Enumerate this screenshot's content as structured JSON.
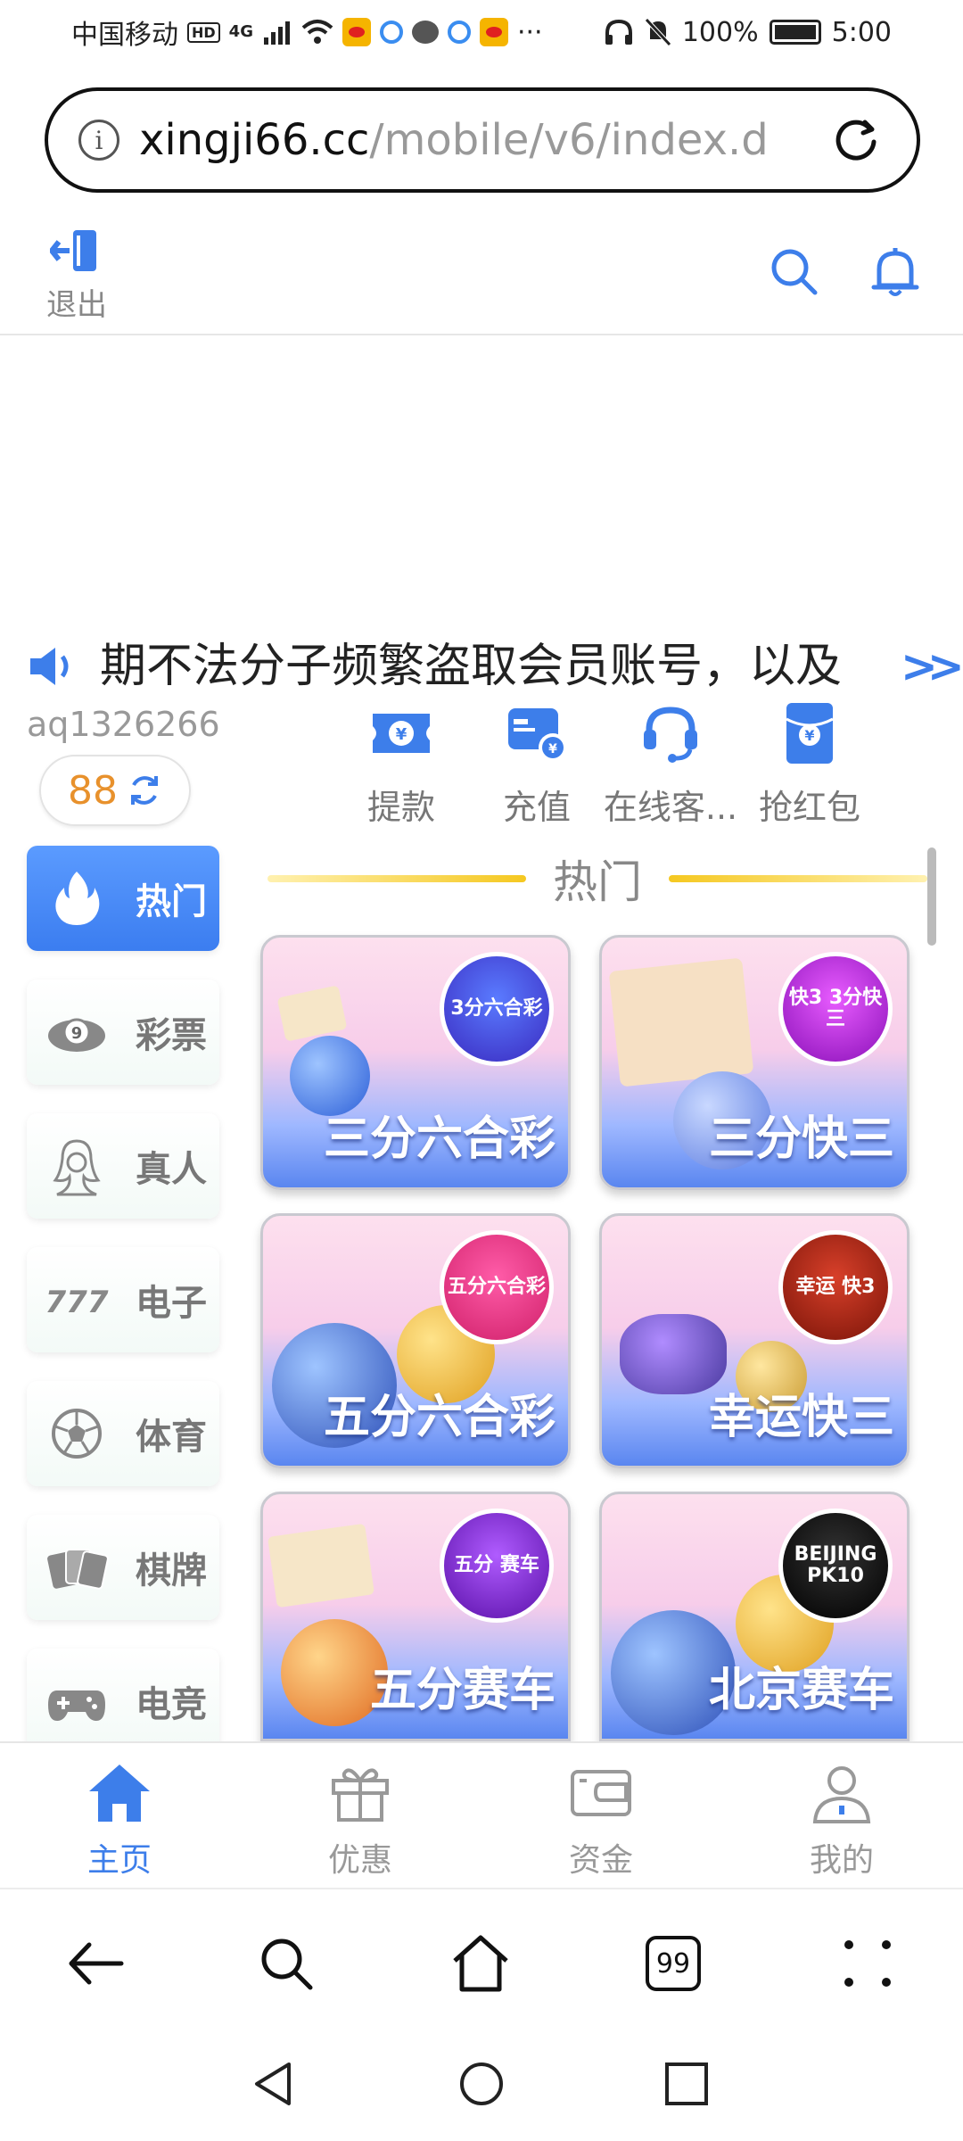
{
  "status_bar": {
    "carrier": "中国移动",
    "hd": "HD",
    "network": "4G",
    "more": "···",
    "battery": "100%",
    "time": "5:00"
  },
  "browser": {
    "url_host": "xingji66.cc",
    "url_path": "/mobile/v6/index.d"
  },
  "header": {
    "logout_label": "退出"
  },
  "notice": {
    "text": "期不法分子频繁盗取会员账号，以及"
  },
  "user": {
    "username": "aq1326266",
    "balance": "88"
  },
  "quick_actions": [
    {
      "label": "提款",
      "icon": "withdraw-ticket-icon"
    },
    {
      "label": "充值",
      "icon": "recharge-wallet-icon"
    },
    {
      "label": "在线客...",
      "icon": "customer-service-headset-icon"
    },
    {
      "label": "抢红包",
      "icon": "red-envelope-icon"
    }
  ],
  "sidebar": {
    "items": [
      {
        "label": "热门",
        "icon": "flame-icon",
        "active": true
      },
      {
        "label": "彩票",
        "icon": "lottery-balls-icon"
      },
      {
        "label": "真人",
        "icon": "live-dealer-icon"
      },
      {
        "label": "电子",
        "icon": "slot-777-icon"
      },
      {
        "label": "体育",
        "icon": "soccer-ball-icon"
      },
      {
        "label": "棋牌",
        "icon": "playing-cards-icon"
      },
      {
        "label": "电竞",
        "icon": "gamepad-icon"
      }
    ]
  },
  "section": {
    "title": "热门"
  },
  "games": [
    {
      "title": "三分六合彩",
      "badge": "3分六合彩"
    },
    {
      "title": "三分快三",
      "badge": "快3 3分快三"
    },
    {
      "title": "五分六合彩",
      "badge": "五分六合彩"
    },
    {
      "title": "幸运快三",
      "badge": "幸运 快3"
    },
    {
      "title": "五分赛车",
      "badge": "五分 赛车"
    },
    {
      "title": "北京赛车",
      "badge": "BEIJING PK10"
    }
  ],
  "tabbar": {
    "items": [
      {
        "label": "主页",
        "icon": "home-icon",
        "active": true
      },
      {
        "label": "优惠",
        "icon": "gift-icon"
      },
      {
        "label": "资金",
        "icon": "wallet-icon"
      },
      {
        "label": "我的",
        "icon": "profile-icon"
      }
    ]
  },
  "browser_nav": {
    "tab_count": "99"
  },
  "colors": {
    "accent": "#3d7eea",
    "balance": "#e8912c",
    "title_line": "#f5c820"
  }
}
